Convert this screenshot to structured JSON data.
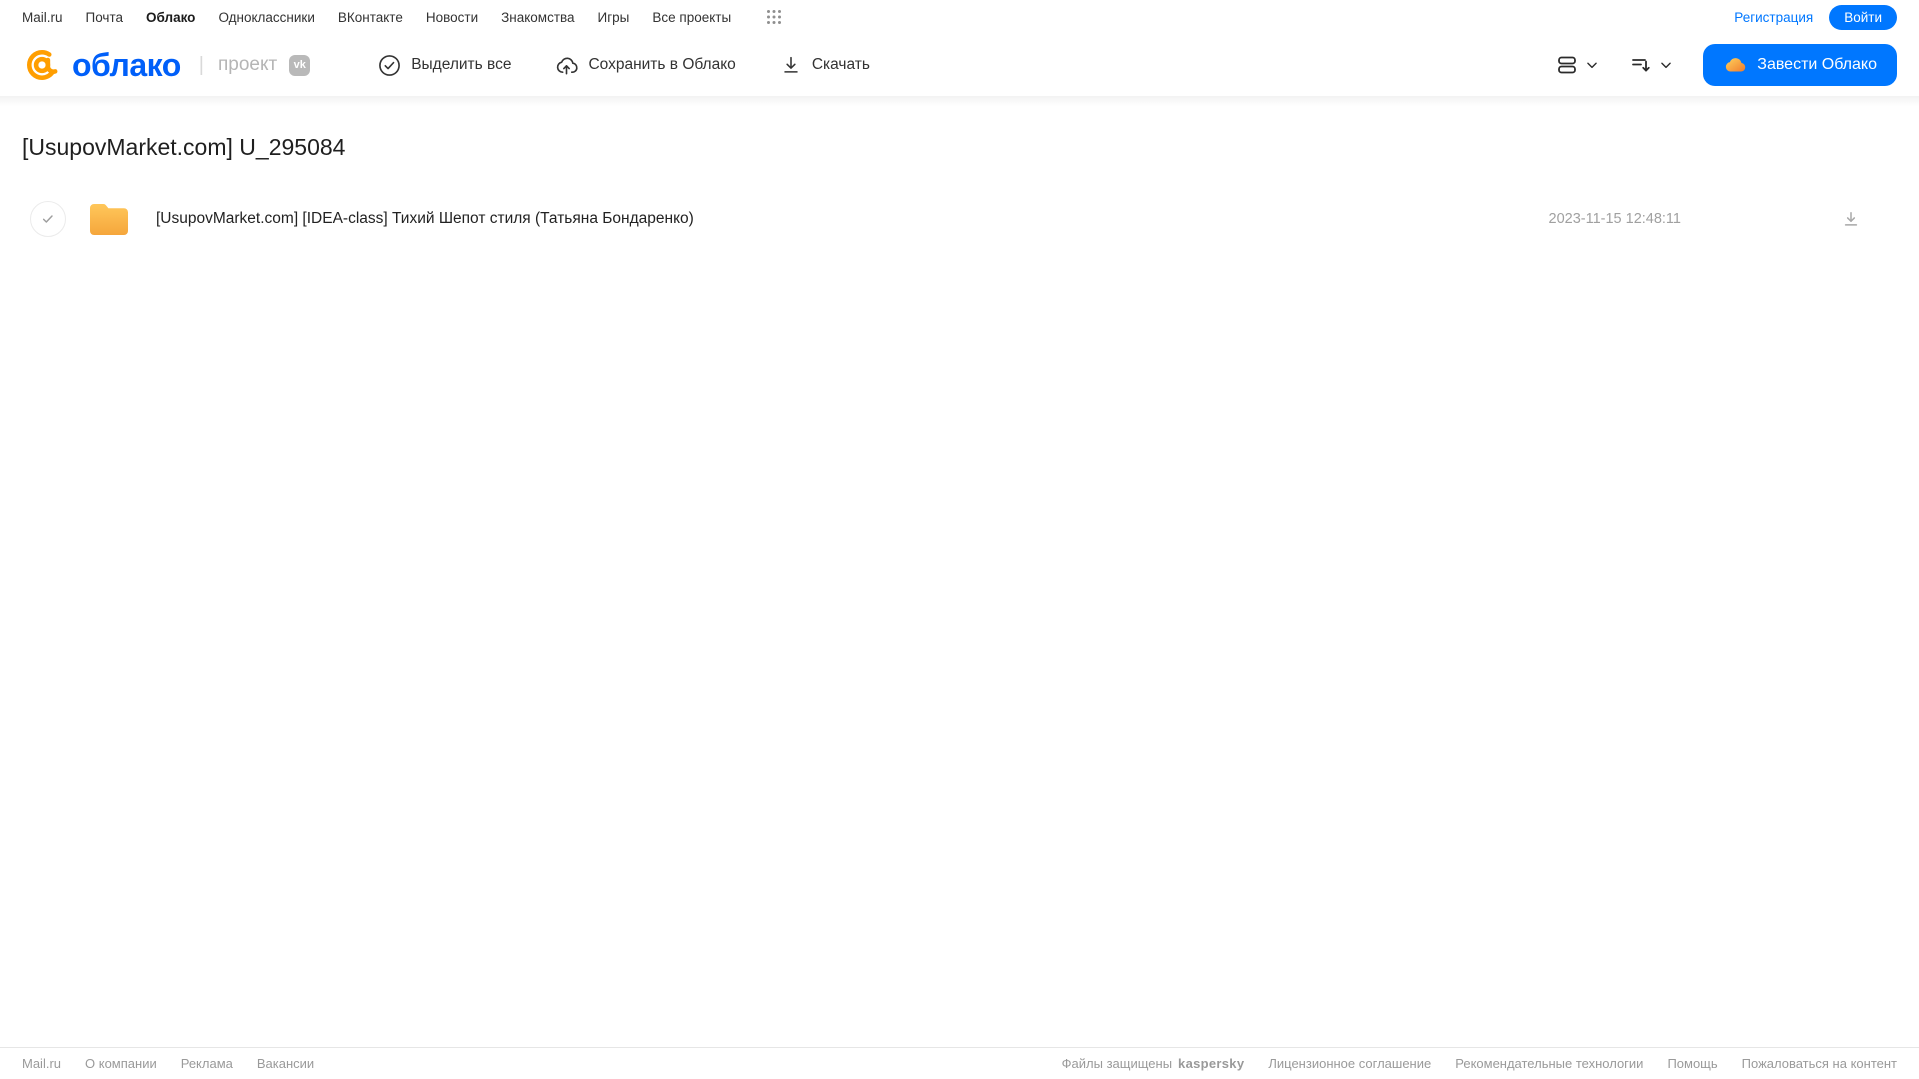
{
  "topnav": {
    "items": [
      {
        "label": "Mail.ru"
      },
      {
        "label": "Почта"
      },
      {
        "label": "Облако"
      },
      {
        "label": "Одноклассники"
      },
      {
        "label": "ВКонтакте"
      },
      {
        "label": "Новости"
      },
      {
        "label": "Знакомства"
      },
      {
        "label": "Игры"
      },
      {
        "label": "Все проекты"
      }
    ],
    "registration_label": "Регистрация",
    "login_label": "Войти"
  },
  "header": {
    "logo": {
      "brand": "облако",
      "divider": "|",
      "project_label": "проект",
      "vk_badge": "vk"
    },
    "toolbar": {
      "select_all_label": "Выделить все",
      "save_to_cloud_label": "Сохранить в Облако",
      "download_label": "Скачать"
    },
    "cta_label": "Завести Облако"
  },
  "main": {
    "title": "[UsupovMarket.com] U_295084",
    "files": [
      {
        "name": "[UsupovMarket.com] [IDEA-class] Тихий Шепот стиля (Татьяна Бондаренко)",
        "modified": "2023-11-15 12:48:11"
      }
    ]
  },
  "footer": {
    "left_links": [
      "Mail.ru",
      "О компании",
      "Реклама",
      "Вакансии"
    ],
    "protected_label": "Файлы защищены",
    "kaspersky_label": "kaspersky",
    "right_links": [
      "Лицензионное соглашение",
      "Рекомендательные технологии",
      "Помощь",
      "Пожаловаться на контент"
    ]
  },
  "colors": {
    "accent_blue": "#0077ff",
    "logo_blue": "#005ff9",
    "logo_orange": "#ff9e00",
    "folder_top": "#ffc75a",
    "folder_bottom": "#f5a63c",
    "kaspersky_teal": "#009982",
    "text_dark": "#333333",
    "text_gray": "#9a9a9a"
  }
}
